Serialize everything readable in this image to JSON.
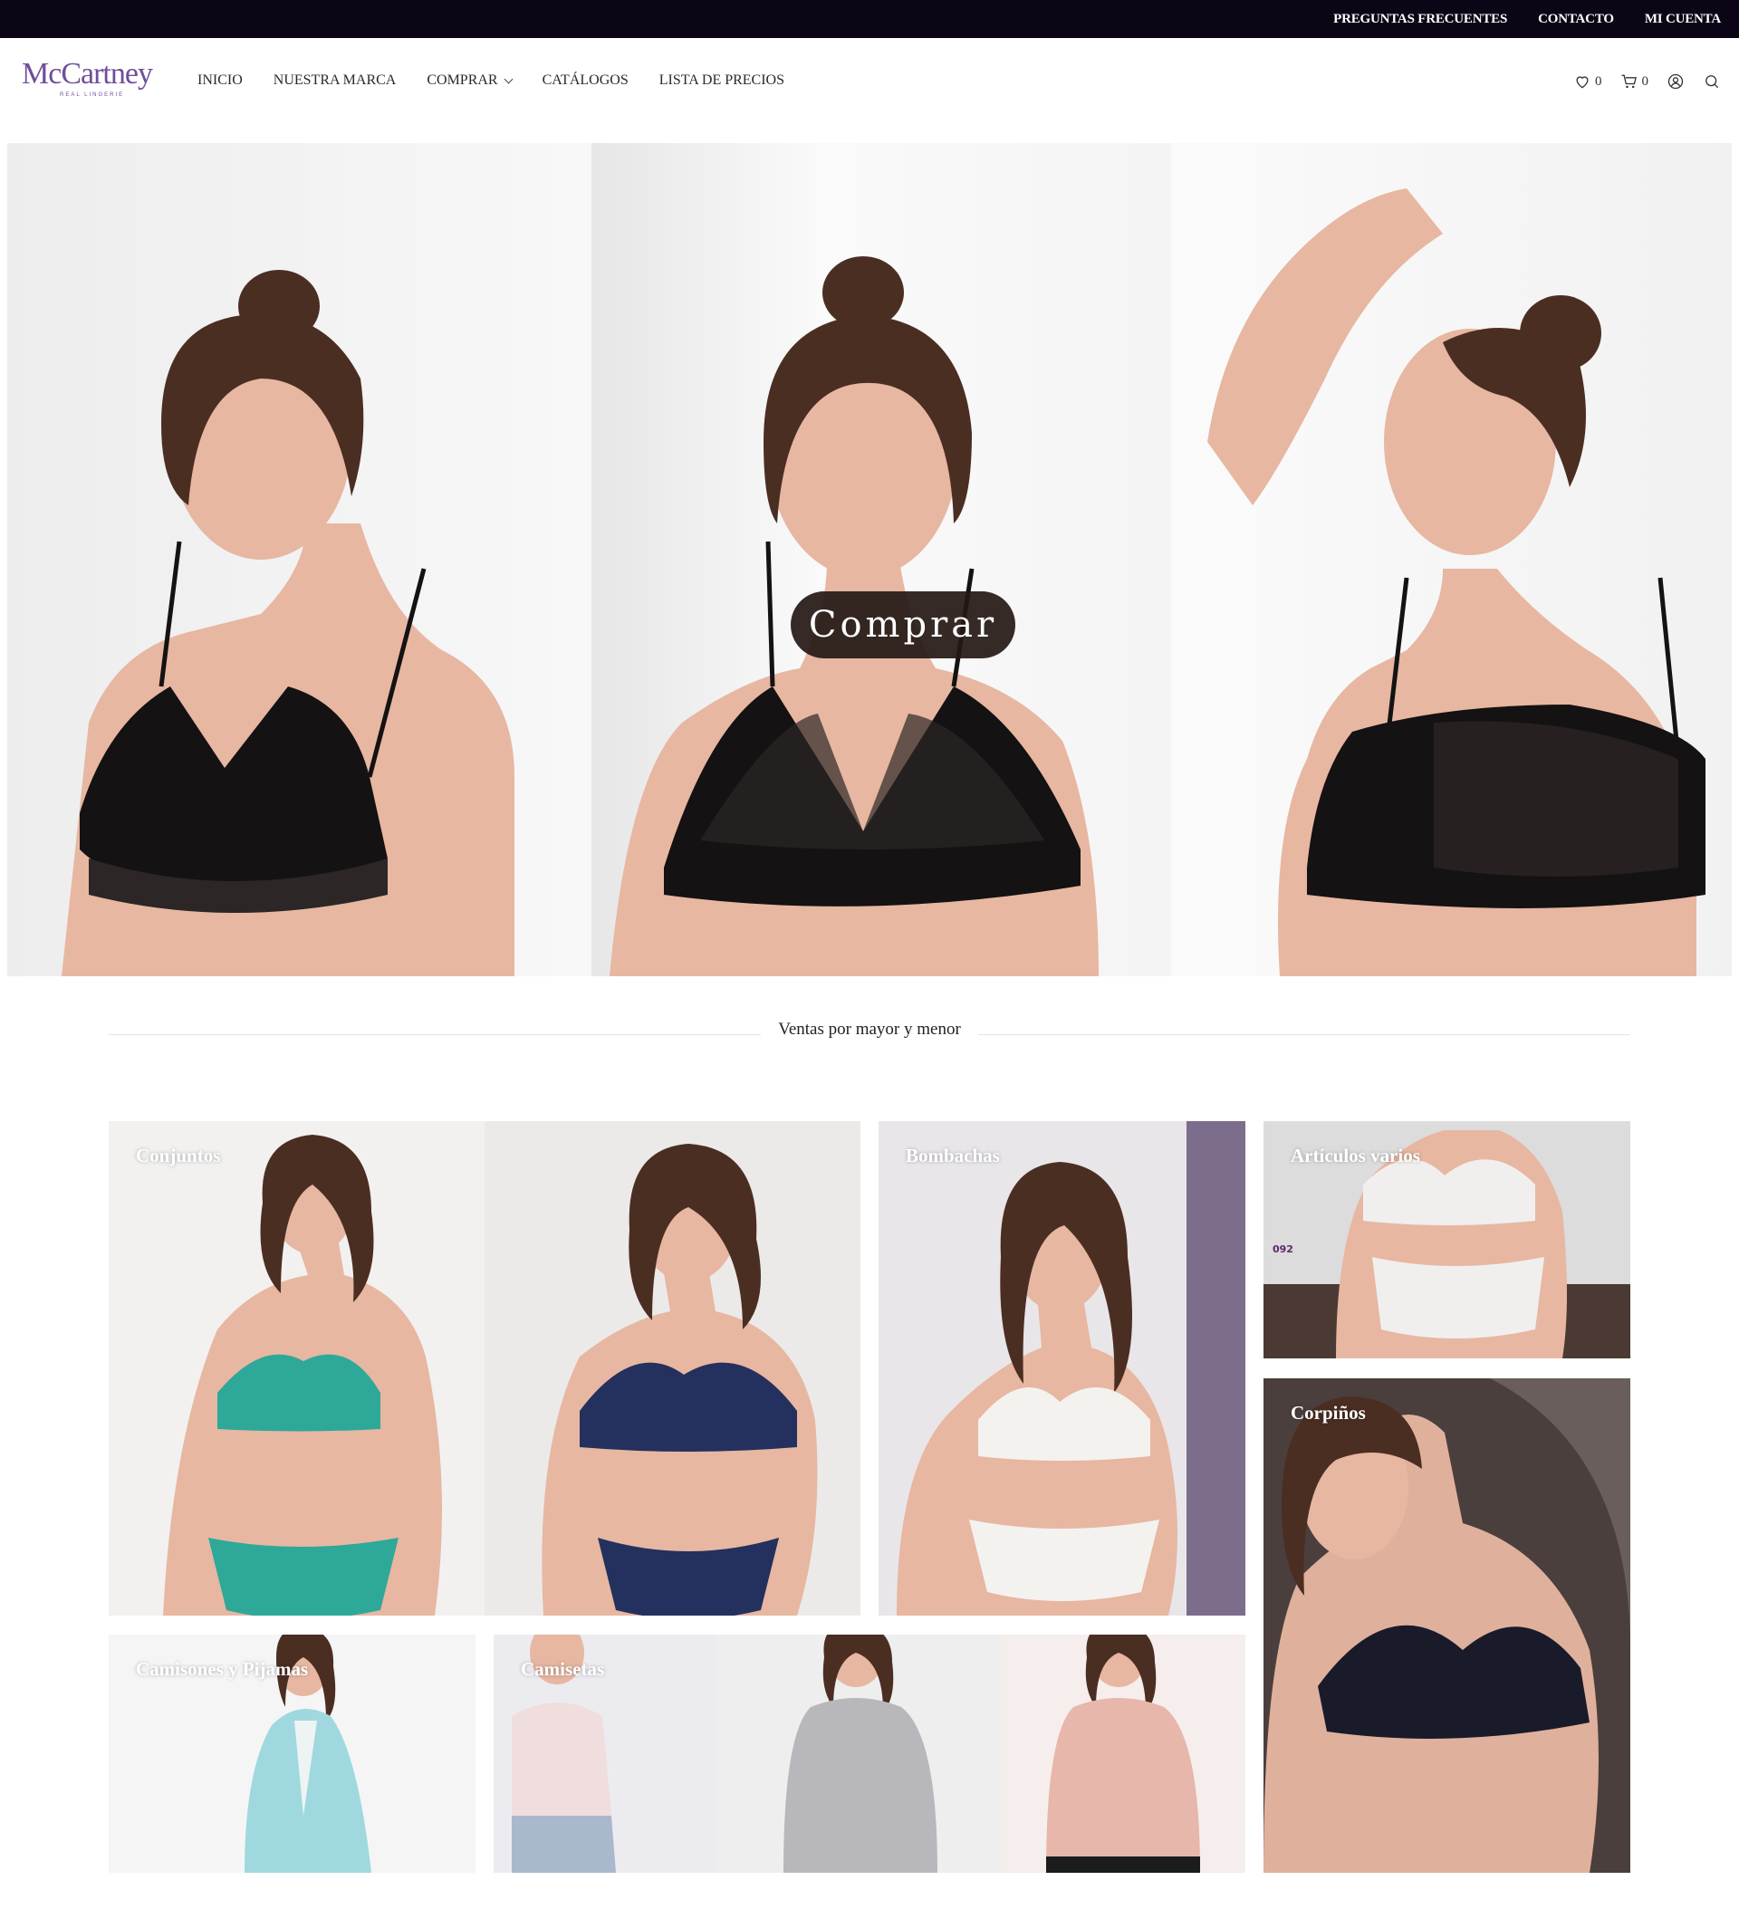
{
  "topbar": {
    "links": [
      "PREGUNTAS FRECUENTES",
      "CONTACTO",
      "MI CUENTA"
    ]
  },
  "header": {
    "logo": {
      "word": "McCartney",
      "sub": "REAL LINGERIE"
    },
    "nav": [
      "INICIO",
      "NUESTRA MARCA",
      "COMPRAR",
      "CATÁLOGOS",
      "LISTA DE PRECIOS"
    ],
    "wishlist_count": "0",
    "cart_count": "0"
  },
  "hero": {
    "cta_label": "Comprar"
  },
  "section": {
    "divider_text": "Ventas por mayor y menor"
  },
  "categories": [
    {
      "label": "Conjuntos"
    },
    {
      "label": "Bombachas"
    },
    {
      "label": "Artículos varios",
      "badge": "092"
    },
    {
      "label": "Corpiños"
    },
    {
      "label": "Camisones y Pijamas"
    },
    {
      "label": "Camisetas"
    }
  ],
  "colors": {
    "topbar_bg": "#0b0515",
    "logo": "#6f4e9a",
    "cta_bg": "#241814"
  }
}
